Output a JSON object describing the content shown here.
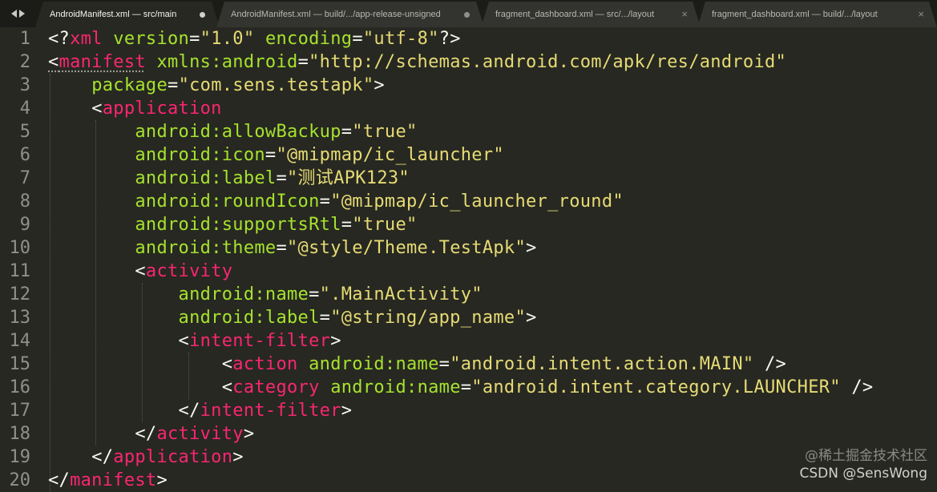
{
  "tabs": [
    {
      "label": "AndroidManifest.xml — src/main",
      "active": true,
      "indicator": "dirty-dot"
    },
    {
      "label": "AndroidManifest.xml — build/.../app-release-unsigned",
      "active": false,
      "indicator": "dirty-dot"
    },
    {
      "label": "fragment_dashboard.xml — src/.../layout",
      "active": false,
      "indicator": "close"
    },
    {
      "label": "fragment_dashboard.xml — build/.../layout",
      "active": false,
      "indicator": "close"
    }
  ],
  "tab_close_glyph": "×",
  "line_numbers": [
    "1",
    "2",
    "3",
    "4",
    "5",
    "6",
    "7",
    "8",
    "9",
    "10",
    "11",
    "12",
    "13",
    "14",
    "15",
    "16",
    "17",
    "18",
    "19",
    "20"
  ],
  "code": {
    "l1": [
      "<?",
      "xml",
      " ",
      "version",
      "=",
      "\"1.0\"",
      " ",
      "encoding",
      "=",
      "\"utf-8\"",
      "?>"
    ],
    "l2": [
      "<",
      "manifest",
      " ",
      "xmlns:android",
      "=",
      "\"http://schemas.android.com/apk/res/android\""
    ],
    "l3": [
      "    ",
      "package",
      "=",
      "\"com.sens.testapk\"",
      ">"
    ],
    "l4": [
      "    ",
      "<",
      "application"
    ],
    "l5": [
      "        ",
      "android:allowBackup",
      "=",
      "\"true\""
    ],
    "l6": [
      "        ",
      "android:icon",
      "=",
      "\"@mipmap/ic_launcher\""
    ],
    "l7": [
      "        ",
      "android:label",
      "=",
      "\"测试APK123\""
    ],
    "l8": [
      "        ",
      "android:roundIcon",
      "=",
      "\"@mipmap/ic_launcher_round\""
    ],
    "l9": [
      "        ",
      "android:supportsRtl",
      "=",
      "\"true\""
    ],
    "l10": [
      "        ",
      "android:theme",
      "=",
      "\"@style/Theme.TestApk\"",
      ">"
    ],
    "l11": [
      "        ",
      "<",
      "activity"
    ],
    "l12": [
      "            ",
      "android:name",
      "=",
      "\".MainActivity\""
    ],
    "l13": [
      "            ",
      "android:label",
      "=",
      "\"@string/app_name\"",
      ">"
    ],
    "l14": [
      "            ",
      "<",
      "intent-filter",
      ">"
    ],
    "l15": [
      "                ",
      "<",
      "action",
      " ",
      "android:name",
      "=",
      "\"android.intent.action.MAIN\"",
      " />"
    ],
    "l16": [
      "                ",
      "<",
      "category",
      " ",
      "android:name",
      "=",
      "\"android.intent.category.LAUNCHER\"",
      " />"
    ],
    "l17": [
      "            ",
      "</",
      "intent-filter",
      ">"
    ],
    "l18": [
      "        ",
      "</",
      "activity",
      ">"
    ],
    "l19": [
      "    ",
      "</",
      "application",
      ">"
    ],
    "l20": [
      "</",
      "manifest",
      ">"
    ]
  },
  "watermark": {
    "line1": "@稀土掘金技术社区",
    "line2": "CSDN @SensWong"
  },
  "colors": {
    "background": "#272822",
    "tag": "#f92672",
    "attribute": "#a6e22e",
    "string": "#e6db74",
    "text": "#f8f8f2",
    "gutter": "#8f908a"
  }
}
